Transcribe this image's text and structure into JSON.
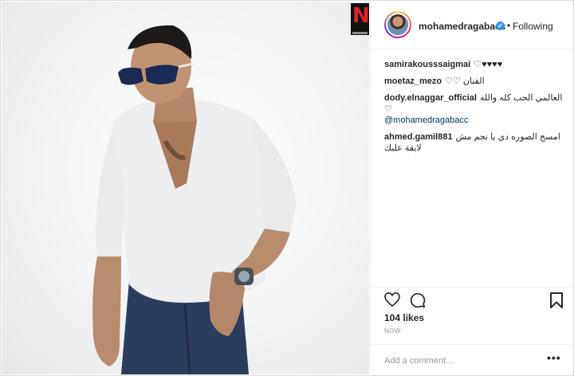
{
  "post": {
    "owner": "mohamedragabacc",
    "follow_status": "Following",
    "separator": "•",
    "verified_glyph": "✔",
    "likes": "104 likes",
    "timestamp": "NOW",
    "comment_placeholder": "Add a comment...",
    "more_glyph": "•••"
  },
  "comments": [
    {
      "author": "samirakousssaigmai",
      "text": "♡♥♥♥♥"
    },
    {
      "author": "moetaz_mezo",
      "text": "الفنان ♡♡"
    },
    {
      "author": "dody.elnaggar_official",
      "text": "العالمي الحب كله والله ♡",
      "mention": "@mohamedragabacc"
    },
    {
      "author": "ahmed.gamil881",
      "text": "امسح الصوره دي يا نجم مش لايقة عليك"
    }
  ],
  "icons": {
    "like": "heart-icon",
    "comment": "comment-icon",
    "save": "bookmark-icon",
    "verified": "verified-badge-icon",
    "more": "more-options-icon"
  },
  "colors": {
    "text": "#262626",
    "muted": "#999999",
    "verified": "#3897f0",
    "border": "#efefef",
    "mention": "#003569"
  }
}
